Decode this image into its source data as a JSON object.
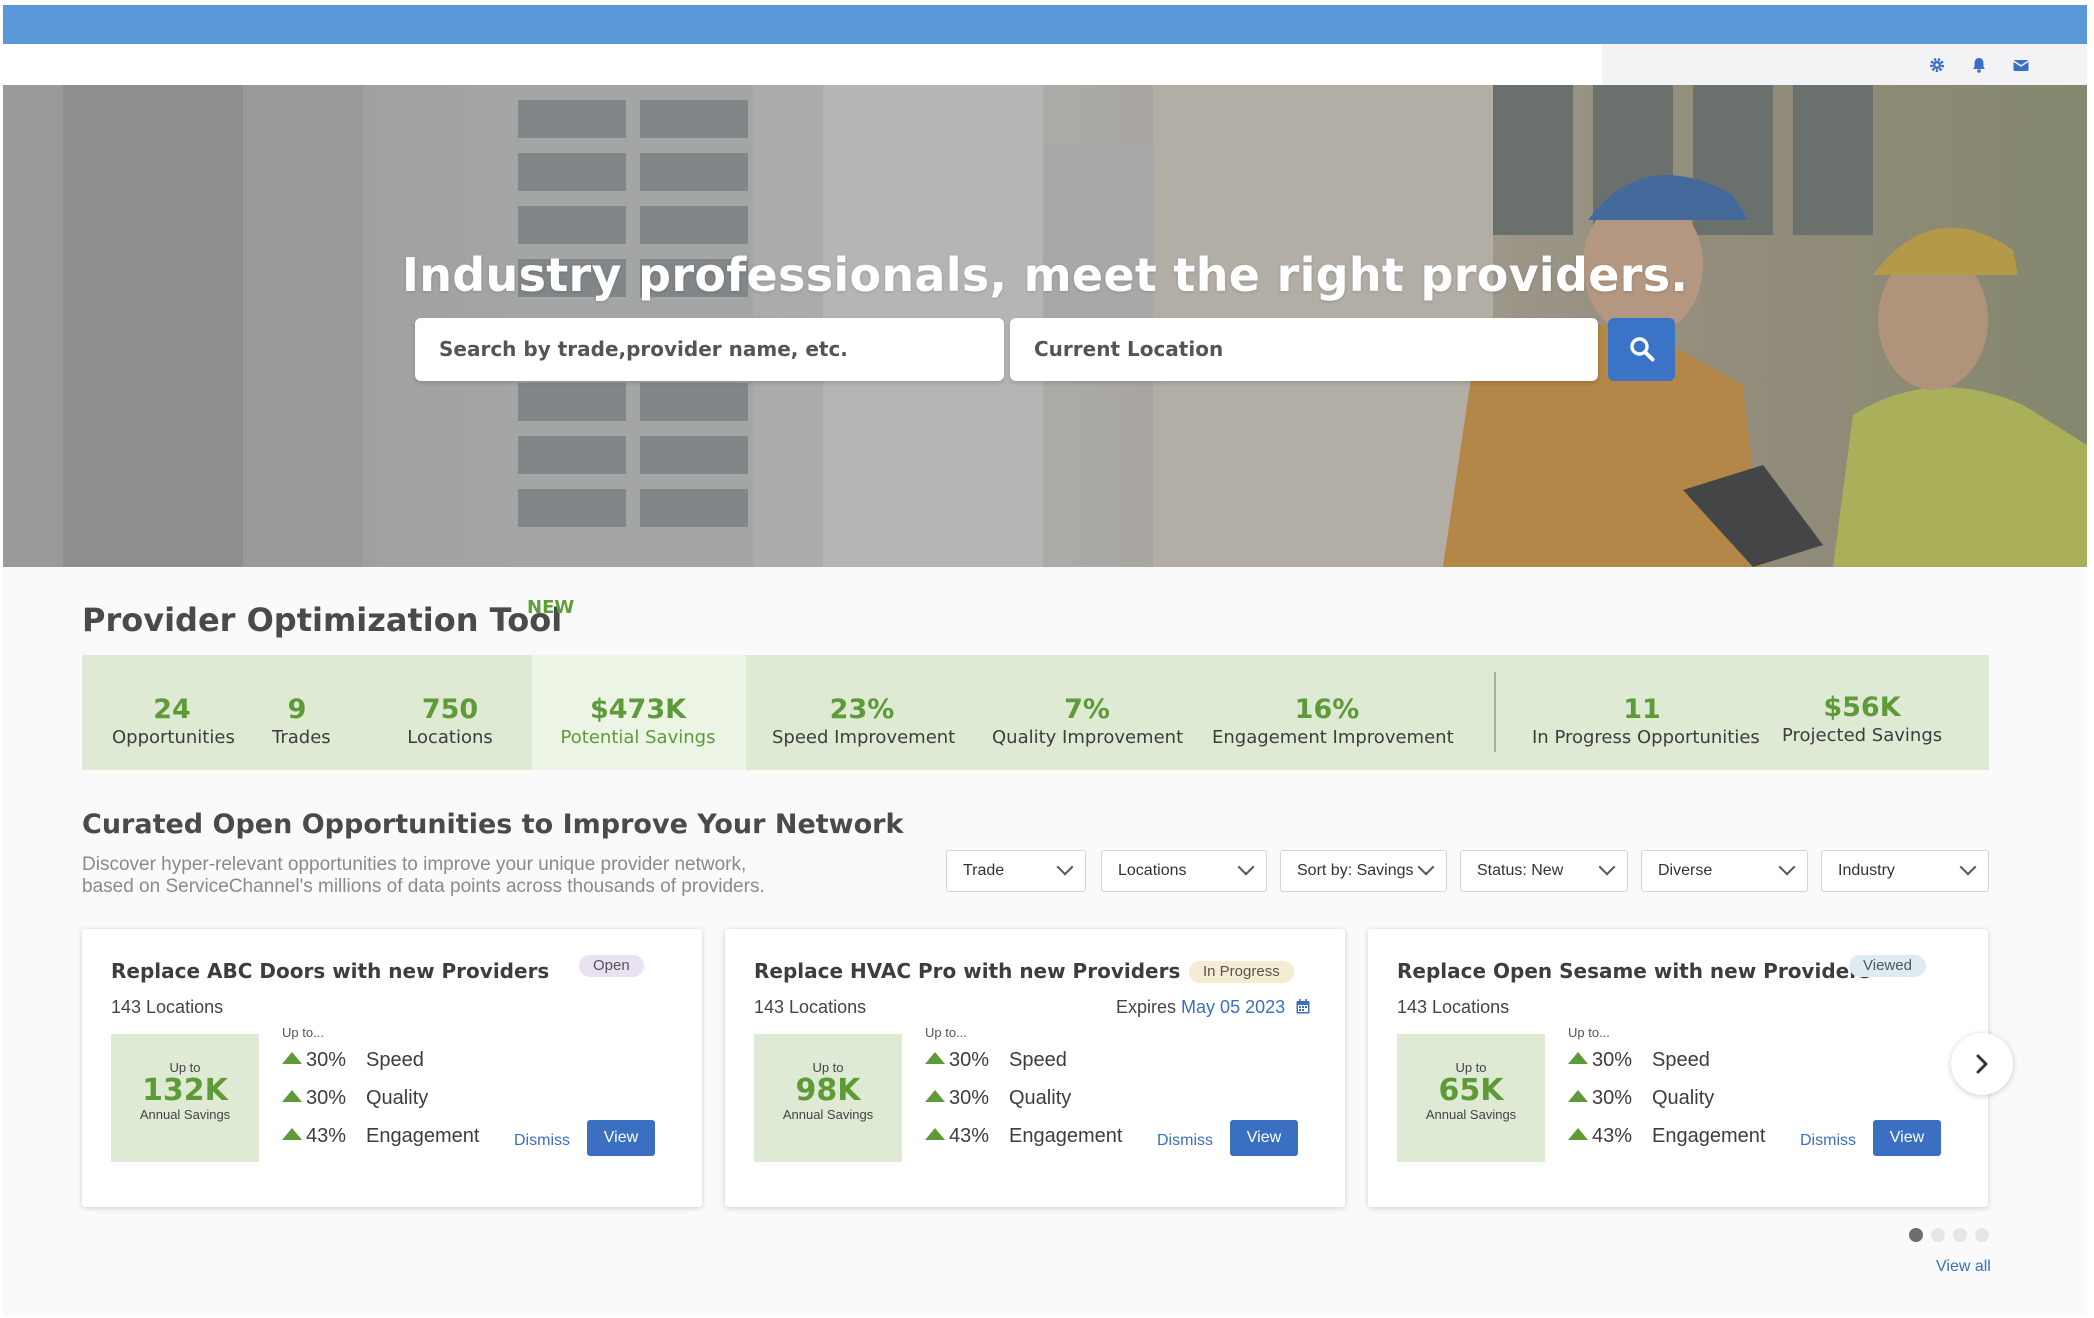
{
  "hero": {
    "title": "Industry professionals, meet the right providers.",
    "search_placeholder": "Search by trade,provider name, etc.",
    "location_placeholder": "Current Location"
  },
  "tool": {
    "title": "Provider Optimization Tool",
    "badge": "NEW",
    "stats": [
      {
        "value": "24",
        "label": "Opportunities"
      },
      {
        "value": "9",
        "label": "Trades"
      },
      {
        "value": "750",
        "label": "Locations"
      },
      {
        "value": "$473K",
        "label": "Potential Savings"
      },
      {
        "value": "23%",
        "label": "Speed Improvement"
      },
      {
        "value": "7%",
        "label": "Quality Improvement"
      },
      {
        "value": "16%",
        "label": "Engagement Improvement"
      },
      {
        "value": "11",
        "label": "In Progress Opportunities"
      },
      {
        "value": "$56K",
        "label": "Projected Savings"
      }
    ]
  },
  "curated": {
    "title": "Curated Open Opportunities to Improve Your Network",
    "desc_line1": "Discover hyper-relevant opportunities to improve your unique provider network,",
    "desc_line2": "based on ServiceChannel's millions of data points across thousands of providers.",
    "filters": [
      "Trade",
      "Locations",
      "Sort by: Savings",
      "Status: New",
      "Diverse",
      "Industry"
    ]
  },
  "cards": [
    {
      "title": "Replace ABC Doors with new Providers",
      "status": "Open",
      "locations": "143 Locations",
      "expires_label": "",
      "expires_date": "",
      "up_to": "Up to",
      "savings": "132K",
      "savings_label": "Annual Savings",
      "upto_label": "Up to...",
      "metrics": [
        {
          "pct": "30%",
          "name": "Speed"
        },
        {
          "pct": "30%",
          "name": "Quality"
        },
        {
          "pct": "43%",
          "name": "Engagement"
        }
      ],
      "dismiss": "Dismiss",
      "view": "View"
    },
    {
      "title": "Replace HVAC Pro with new Providers",
      "status": "In Progress",
      "locations": "143 Locations",
      "expires_label": "Expires",
      "expires_date": "May 05 2023",
      "up_to": "Up to",
      "savings": "98K",
      "savings_label": "Annual Savings",
      "upto_label": "Up to...",
      "metrics": [
        {
          "pct": "30%",
          "name": "Speed"
        },
        {
          "pct": "30%",
          "name": "Quality"
        },
        {
          "pct": "43%",
          "name": "Engagement"
        }
      ],
      "dismiss": "Dismiss",
      "view": "View"
    },
    {
      "title": "Replace Open Sesame with new Providers",
      "status": "Viewed",
      "locations": "143 Locations",
      "expires_label": "",
      "expires_date": "",
      "up_to": "Up to",
      "savings": "65K",
      "savings_label": "Annual Savings",
      "upto_label": "Up to...",
      "metrics": [
        {
          "pct": "30%",
          "name": "Speed"
        },
        {
          "pct": "30%",
          "name": "Quality"
        },
        {
          "pct": "43%",
          "name": "Engagement"
        }
      ],
      "dismiss": "Dismiss",
      "view": "View"
    }
  ],
  "carousel": {
    "active_dot": 1,
    "dot_count": 4
  },
  "view_all": "View all",
  "colors": {
    "topbar": "#5b98d8",
    "accent_green": "#5f9a38",
    "stat_bg": "#dfead5",
    "primary_blue": "#3b6fc2"
  },
  "icons": {
    "settings": "gear-icon",
    "notifications": "bell-icon",
    "messages": "envelope-icon",
    "search": "search-icon",
    "next": "chevron-right-icon",
    "calendar": "calendar-icon"
  }
}
